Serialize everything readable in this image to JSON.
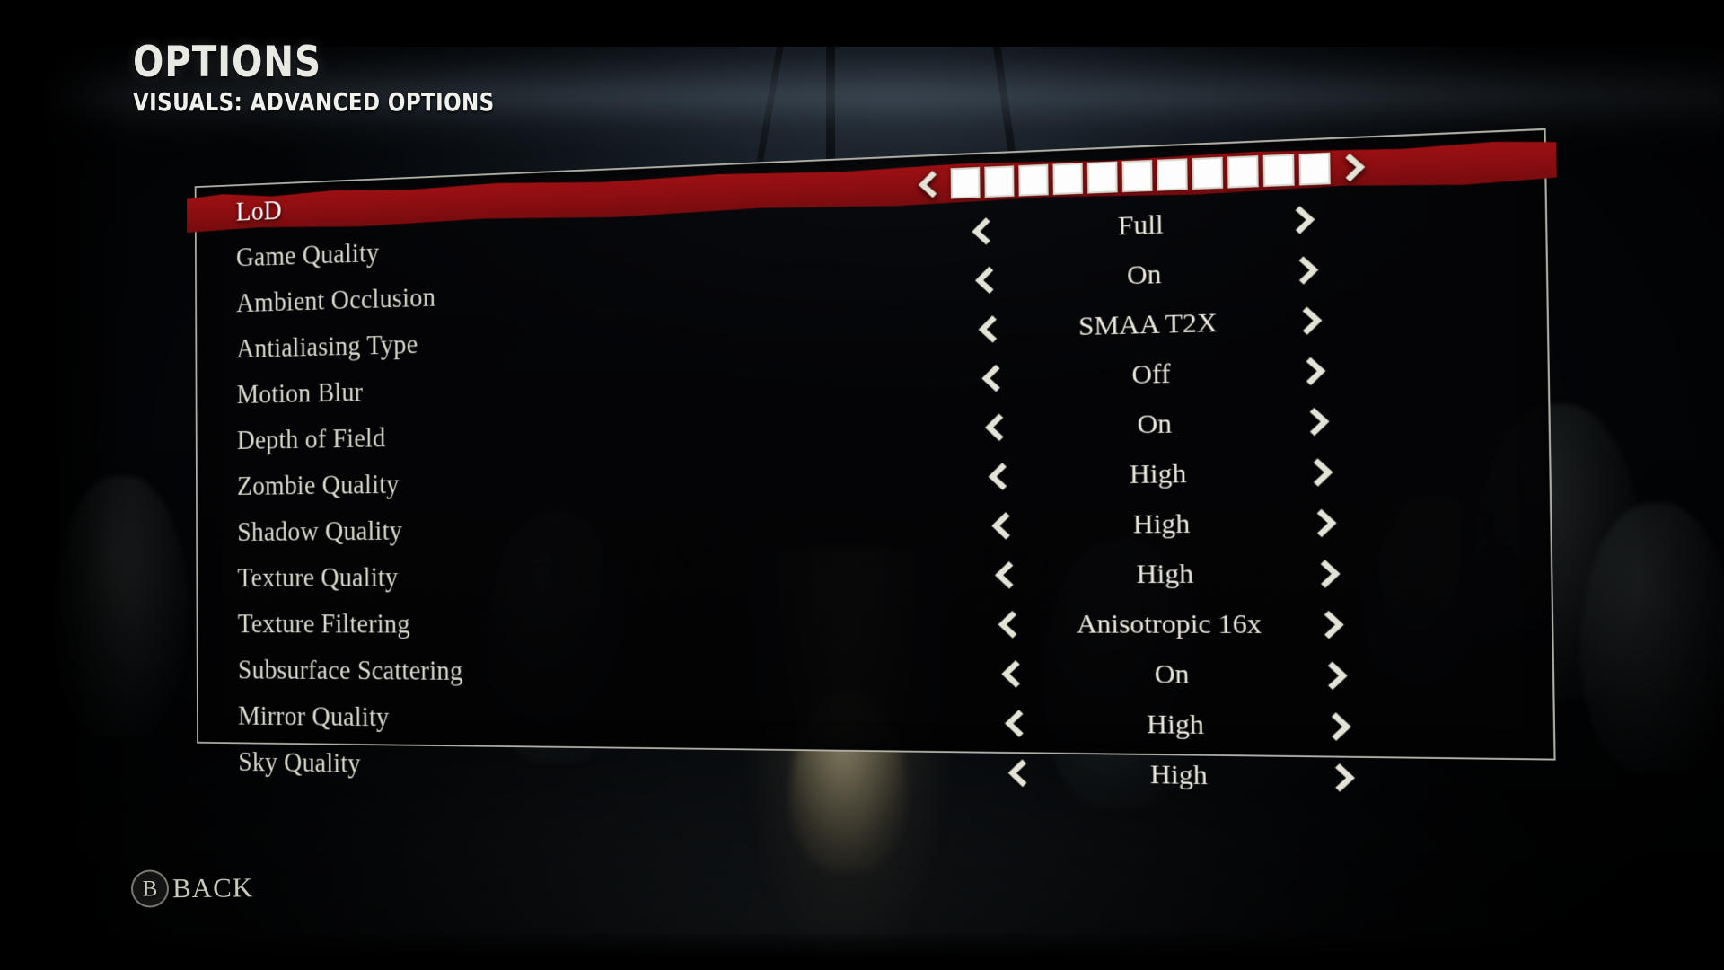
{
  "header": {
    "title": "OPTIONS",
    "subtitle": "VISUALS: ADVANCED OPTIONS"
  },
  "colors": {
    "highlight_red": "#8e0e11",
    "text_cream": "#d8d8cc",
    "value_cream": "#ece9df",
    "frame_border": "#dedece",
    "segment_fill": "#fdfdfd"
  },
  "icons": {
    "left_arrow": "chevron-left-icon",
    "right_arrow": "chevron-right-icon",
    "back_button": "b-button-icon"
  },
  "menu": {
    "selected_index": 0,
    "rows": [
      {
        "label": "LoD",
        "control": "slider",
        "segments_total": 11,
        "segments_filled": 11,
        "selected": true
      },
      {
        "label": "Game Quality",
        "control": "stepper",
        "value": "Full",
        "selected": false
      },
      {
        "label": "Ambient Occlusion",
        "control": "stepper",
        "value": "On",
        "selected": false
      },
      {
        "label": "Antialiasing Type",
        "control": "stepper",
        "value": "SMAA T2X",
        "selected": false
      },
      {
        "label": "Motion Blur",
        "control": "stepper",
        "value": "Off",
        "selected": false
      },
      {
        "label": "Depth of Field",
        "control": "stepper",
        "value": "On",
        "selected": false
      },
      {
        "label": "Zombie Quality",
        "control": "stepper",
        "value": "High",
        "selected": false
      },
      {
        "label": "Shadow Quality",
        "control": "stepper",
        "value": "High",
        "selected": false
      },
      {
        "label": "Texture Quality",
        "control": "stepper",
        "value": "High",
        "selected": false
      },
      {
        "label": "Texture Filtering",
        "control": "stepper",
        "value": "Anisotropic 16x",
        "selected": false
      },
      {
        "label": "Subsurface Scattering",
        "control": "stepper",
        "value": "On",
        "selected": false
      },
      {
        "label": "Mirror Quality",
        "control": "stepper",
        "value": "High",
        "selected": false
      },
      {
        "label": "Sky Quality",
        "control": "stepper",
        "value": "High",
        "selected": false
      }
    ]
  },
  "footer": {
    "back_glyph": "B",
    "back_label": "BACK"
  }
}
